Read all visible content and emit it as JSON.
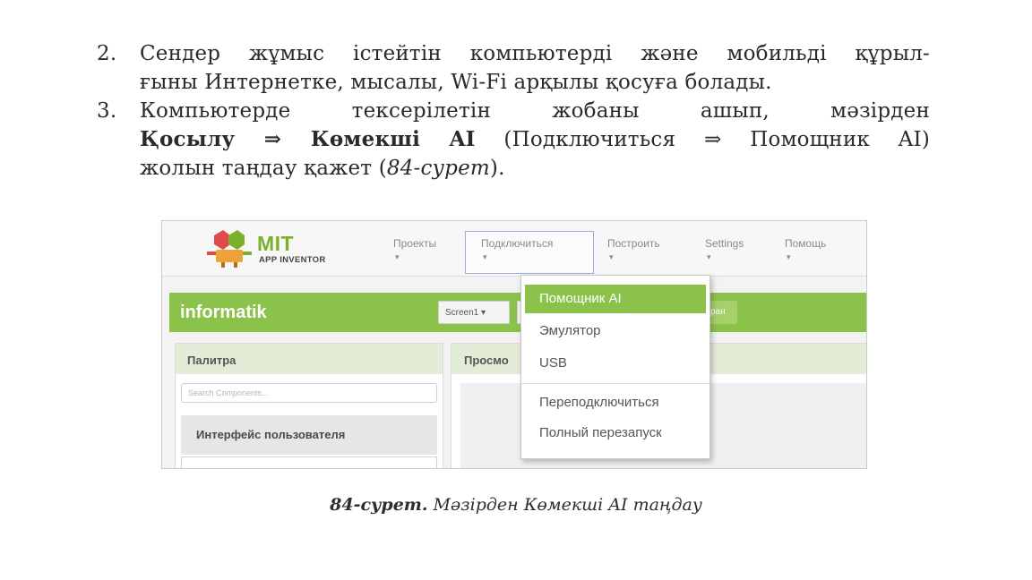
{
  "document": {
    "items": [
      {
        "num": "2.",
        "line1": "Сендер жұмыс істейтін компьютерді және мобильді құрыл-",
        "line2": "ғыны Интернетке, мысалы, Wi-Fi арқылы қосуға болады."
      },
      {
        "num": "3.",
        "line1": "Компьютерде тексерілетін жобаны ашып, мәзірден",
        "line2_bold": "Қосылу ⇒ Көмекші AI",
        "line2_rest": " (Подключиться ⇒ Помощник AI)",
        "line3_start": "жолын таңдау қажет (",
        "line3_ref": "84-сурет",
        "line3_end": ")."
      }
    ],
    "caption": {
      "number": "84-сурет.",
      "text": " Мәзірден Көмекші AI таңдау"
    }
  },
  "app": {
    "logo": {
      "title": "MIT",
      "subtitle": "APP INVENTOR",
      "icon": "app-inventor-logo-icon"
    },
    "menu": [
      {
        "label": "Проекты",
        "caret": "▾"
      },
      {
        "label": "Подключиться",
        "caret": "▾"
      },
      {
        "label": "Построить",
        "caret": "▾"
      },
      {
        "label": "Settings",
        "caret": "▾"
      },
      {
        "label": "Помощь",
        "caret": "▾"
      }
    ],
    "project_name": "informatik",
    "screen_selector": "Screen1 ▾",
    "partial_button": "ран",
    "palette": {
      "title": "Палитра",
      "search_placeholder": "Search Components...",
      "group": "Интерфейс пользователя"
    },
    "viewer": {
      "title": "Просмо"
    },
    "dropdown": {
      "items": [
        "Помощник AI",
        "Эмулятор",
        "USB",
        "Переподключиться",
        "Полный перезапуск"
      ],
      "active_index": 0
    },
    "colors": {
      "green": "#8bc34a",
      "logo_green": "#7cb02c",
      "panel_head": "#e3ecd7"
    }
  }
}
